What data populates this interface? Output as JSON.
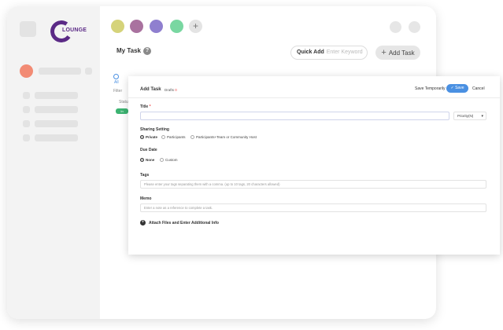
{
  "brand": {
    "logo_text": "LOUNGE"
  },
  "colors": {
    "purple": "#5b2a86",
    "accent_blue": "#4a90e2",
    "required_red": "#e44444",
    "badge_green": "#3cb371"
  },
  "color_dots": [
    "#d5d37a",
    "#a9729f",
    "#8f7fcf",
    "#79d7a1"
  ],
  "main": {
    "title": "My Task",
    "help_icon": "?",
    "quick_add_label": "Quick Add",
    "quick_add_placeholder": "Enter Keyword",
    "add_task_label": "Add Task",
    "behind_all": "All",
    "behind_filter": "Filter",
    "behind_status": "Status",
    "behind_badge": "In Progress"
  },
  "modal": {
    "title": "Add Task",
    "drafts_label": "Drafts",
    "drafts_count": "0",
    "save_temporarily": "Save Temporarily",
    "save": "Save",
    "cancel": "Cancel",
    "title_label": "Title",
    "priority_value": "Priority(N)",
    "sharing_label": "Sharing Setting",
    "sharing_options": [
      "Private",
      "Participants",
      "Participants+Team or Community Host"
    ],
    "due_label": "Due Date",
    "due_options": [
      "None",
      "Custom"
    ],
    "tags_label": "Tags",
    "tags_placeholder": "Please enter your tags separating them with a comma. (up to 10 tags, 20 characters allowed)",
    "memo_label": "Memo",
    "memo_placeholder": "Enter a note as a reference to complete a task.",
    "attach_label": "Attach Files and Enter Additional Info"
  }
}
